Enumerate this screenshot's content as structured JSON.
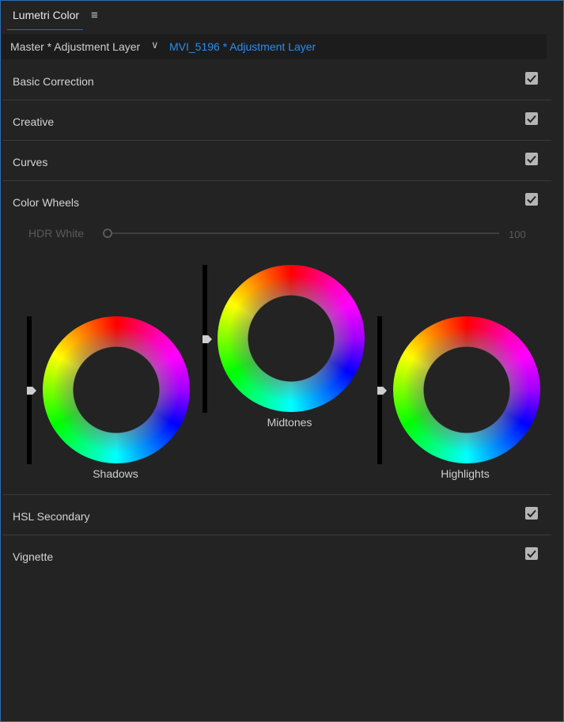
{
  "panel": {
    "title": "Lumetri Color",
    "menu_icon": "≡"
  },
  "clip_selector": {
    "master": "Master * Adjustment Layer",
    "chevron": "∨",
    "current": "MVI_5196 * Adjustment Layer"
  },
  "sections": [
    {
      "label": "Basic Correction",
      "checked": true
    },
    {
      "label": "Creative",
      "checked": true
    },
    {
      "label": "Curves",
      "checked": true
    },
    {
      "label": "Color Wheels",
      "checked": true
    },
    {
      "label": "HSL Secondary",
      "checked": true
    },
    {
      "label": "Vignette",
      "checked": true
    }
  ],
  "color_wheels": {
    "hdr_white_label": "HDR White",
    "hdr_white_value": "100",
    "wheels": [
      {
        "label": "Shadows"
      },
      {
        "label": "Midtones"
      },
      {
        "label": "Highlights"
      }
    ]
  },
  "colors": {
    "accent": "#2d8ceb",
    "border": "#2d6bb3",
    "background": "#232323"
  }
}
